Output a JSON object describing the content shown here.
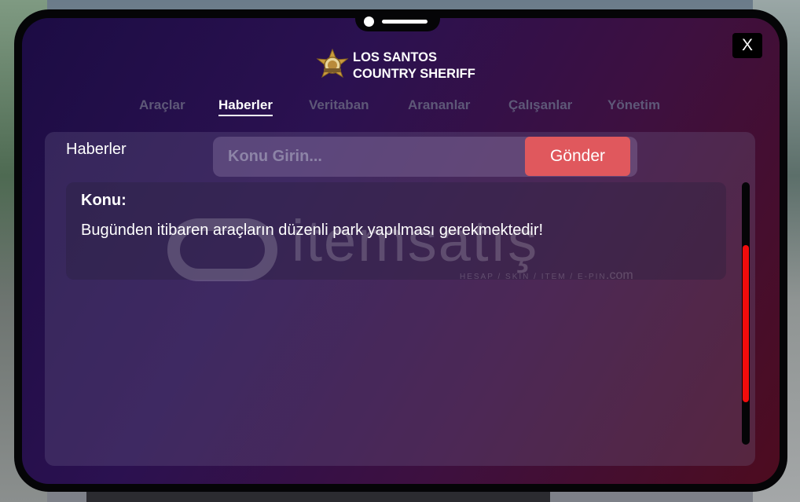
{
  "header": {
    "logo_line1": "LOS SANTOS",
    "logo_line2": "COUNTRY SHERIFF",
    "close_label": "X"
  },
  "nav": {
    "tabs": [
      {
        "label": "Araçlar",
        "active": false
      },
      {
        "label": "Haberler",
        "active": true
      },
      {
        "label": "Veritaban",
        "active": false
      },
      {
        "label": "Arananlar",
        "active": false
      },
      {
        "label": "Çalışanlar",
        "active": false
      },
      {
        "label": "Yönetim",
        "active": false
      }
    ]
  },
  "panel": {
    "title": "Haberler",
    "subject_placeholder": "Konu Girin...",
    "subject_value": "",
    "send_label": "Gönder"
  },
  "news": [
    {
      "label": "Konu:",
      "text": "Bugünden itibaren araçların düzenli park yapılması gerekmektedir!"
    }
  ],
  "watermark": {
    "brand": "itemsatış",
    "tagline": "HESAP / SKIN / ITEM / E-PIN",
    "suffix": ".com"
  },
  "scrollbar": {
    "thumb_start_fraction": 0.24,
    "thumb_size_fraction": 0.6
  },
  "colors": {
    "accent": "#e0585d",
    "scroll_thumb": "#f20c0c",
    "inactive_tab": "#5e5878"
  }
}
